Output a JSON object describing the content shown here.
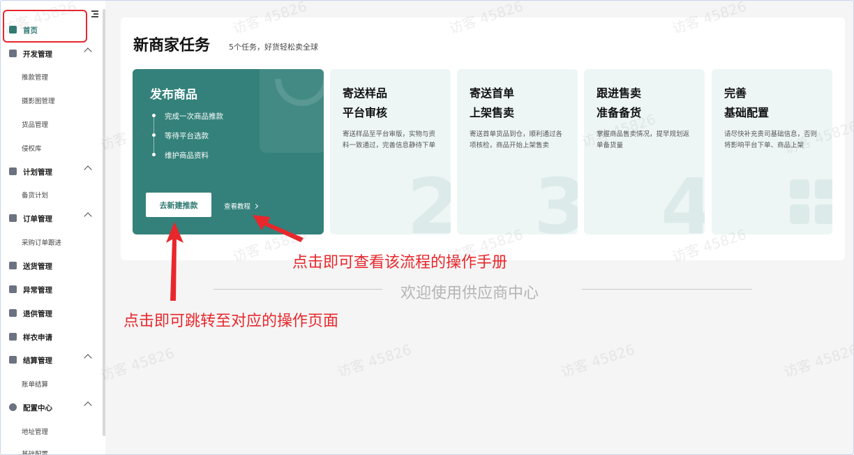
{
  "sidebar": {
    "items": [
      {
        "label": "首页",
        "active": true
      },
      {
        "label": "开发管理",
        "children": [
          "推款管理",
          "摄影图管理",
          "货品管理",
          "侵权库"
        ]
      },
      {
        "label": "计划管理",
        "children": [
          "备货计划"
        ]
      },
      {
        "label": "订单管理",
        "children": [
          "采购订单跟进"
        ]
      },
      {
        "label": "送货管理"
      },
      {
        "label": "异常管理"
      },
      {
        "label": "退供管理"
      },
      {
        "label": "样衣申请"
      },
      {
        "label": "结算管理",
        "children": [
          "账单结算"
        ]
      },
      {
        "label": "配置中心",
        "children": [
          "地址管理",
          "基础配置"
        ]
      }
    ]
  },
  "panel": {
    "title": "新商家任务",
    "subtitle": "5个任务，好货轻松卖全球",
    "main_card": {
      "title": "发布商品",
      "steps": [
        "完成一次商品推款",
        "等待平台选款",
        "维护商品资料"
      ],
      "primary_button": "去新建推款",
      "tutorial_link": "查看教程"
    },
    "cards": [
      {
        "line1": "寄送样品",
        "line2": "平台审核",
        "desc": "寄送样品至平台审版，实物与资料一致通过，完善信息静待下单",
        "number": "2"
      },
      {
        "line1": "寄送首单",
        "line2": "上架售卖",
        "desc": "寄送首单货品到仓，顺利通过各项核检，商品开始上架售卖",
        "number": "3"
      },
      {
        "line1": "跟进售卖",
        "line2": "准备备货",
        "desc": "掌握商品售卖情况，提早规划返单备货量",
        "number": "4"
      },
      {
        "line1": "完善",
        "line2": "基础配置",
        "desc": "请尽快补充贵司基础信息，否则将影响平台下单、商品上架",
        "number": ""
      }
    ]
  },
  "welcome": "欢迎使用供应商中心",
  "annotations": {
    "tutorial_hint": "点击即可查看该流程的操作手册",
    "button_hint": "点击即可跳转至对应的操作页面"
  },
  "watermark": "访客 45826",
  "colors": {
    "accent": "#33817a",
    "annotation": "#e8272c"
  }
}
